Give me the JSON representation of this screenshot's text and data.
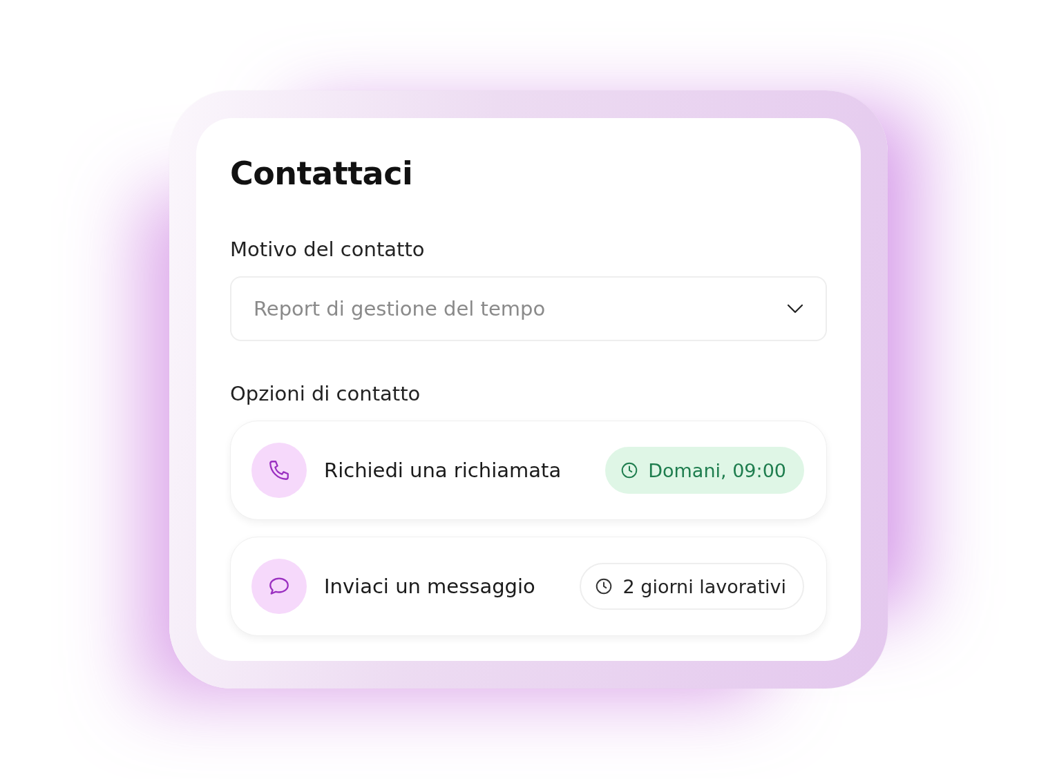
{
  "title": "Contattaci",
  "reason": {
    "label": "Motivo del contatto",
    "placeholder": "Report di gestione del tempo"
  },
  "options_label": "Opzioni di contatto",
  "options": [
    {
      "kind": "phone",
      "label": "Richiedi una richiamata",
      "badge": {
        "text": "Domani, 09:00",
        "highlighted": true
      }
    },
    {
      "kind": "message",
      "label": "Inviaci un messaggio",
      "badge": {
        "text": "2 giorni lavorativi",
        "highlighted": false
      }
    }
  ]
}
